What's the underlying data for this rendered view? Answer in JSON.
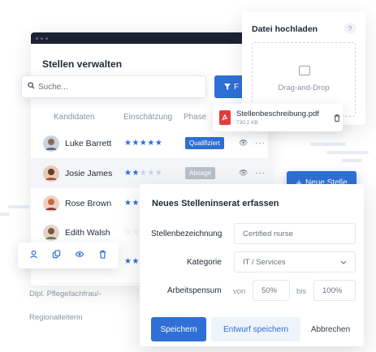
{
  "main": {
    "title": "Stellen verwalten",
    "columns": {
      "candidates": "Kandidaten",
      "rating": "Einschätzung",
      "phase": "Phase"
    },
    "rows": [
      {
        "name": "Luke Barrett",
        "stars": "★★★★★",
        "stars_off": "",
        "phase": "Qualifiziert",
        "phase_color": "#2f6fd6",
        "eye": "👁",
        "more": "···"
      },
      {
        "name": "Josie James",
        "stars": "★★",
        "stars_off": "★★★",
        "phase": "Absage",
        "phase_color": "#b9bfc9",
        "eye": "👁",
        "more": "···"
      },
      {
        "name": "Rose Brown",
        "stars": "★★",
        "stars_off": "",
        "phase": "",
        "phase_color": "",
        "eye": "",
        "more": ""
      },
      {
        "name": "Edith Walsh",
        "stars": "",
        "stars_off": "☆☆",
        "phase": "",
        "phase_color": "",
        "eye": "",
        "more": ""
      },
      {
        "name": "",
        "stars": "★★",
        "stars_off": "",
        "phase": "",
        "phase_color": "",
        "eye": "",
        "more": ""
      }
    ],
    "bg_rows": [
      "Dipl. Pflegefachfrau/-",
      "Regionalleiterin"
    ]
  },
  "search": {
    "placeholder": "Suche...",
    "icon": "search-icon",
    "filter_label": "F"
  },
  "pdf": {
    "filename": "Stellenbeschreibung.pdf",
    "size": "730.2 KB"
  },
  "upload": {
    "title": "Datei hochladen",
    "help": "?",
    "drop_label": "Drag-and-Drop"
  },
  "new_button": {
    "label": "Neue Stelle",
    "plus": "+"
  },
  "form": {
    "title": "Neues Stelleninserat erfassen",
    "fields": {
      "designation_label": "Stellenbezeichnung",
      "designation_value": "Certified nurse",
      "category_label": "Kategorie",
      "category_value": "IT / Services",
      "workload_label": "Arbeitspensum",
      "from_label": "von",
      "from_value": "50%",
      "to_label": "bis",
      "to_value": "100%"
    },
    "buttons": {
      "save": "Speichern",
      "draft": "Entwurf speichern",
      "cancel": "Abbrechen"
    }
  },
  "colors": {
    "accent": "#2f6fd6",
    "titlebar": "#1b2233",
    "danger": "#e23c3c"
  }
}
